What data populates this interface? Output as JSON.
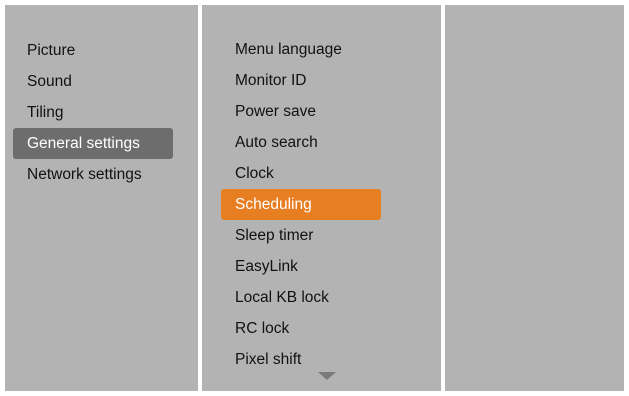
{
  "colors": {
    "panel_background": "#b3b3b3",
    "focused_highlight": "#6d6d6d",
    "selected_highlight": "#e87e22",
    "text": "#111111",
    "highlight_text": "#ffffff"
  },
  "main_menu": {
    "items": [
      {
        "label": "Picture"
      },
      {
        "label": "Sound"
      },
      {
        "label": "Tiling"
      },
      {
        "label": "General settings",
        "state": "focused"
      },
      {
        "label": "Network settings"
      }
    ]
  },
  "submenu": {
    "items": [
      {
        "label": "Menu language"
      },
      {
        "label": "Monitor ID"
      },
      {
        "label": "Power save"
      },
      {
        "label": "Auto search"
      },
      {
        "label": "Clock"
      },
      {
        "label": "Scheduling",
        "state": "selected"
      },
      {
        "label": "Sleep timer"
      },
      {
        "label": "EasyLink"
      },
      {
        "label": "Local KB lock"
      },
      {
        "label": "RC lock"
      },
      {
        "label": "Pixel shift"
      }
    ],
    "more_indicator_icon": "triangle-down-icon"
  },
  "detail_panel": {
    "items": []
  }
}
